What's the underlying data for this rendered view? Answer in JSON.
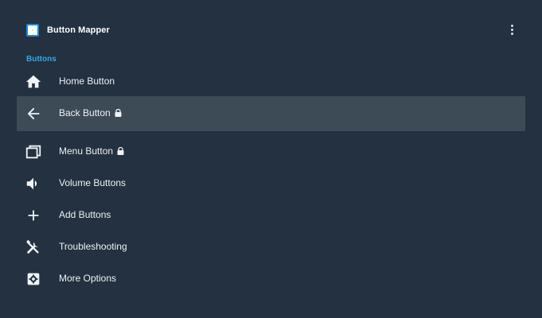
{
  "app": {
    "title": "Button Mapper",
    "icon": "button-mapper-app-icon"
  },
  "header": {
    "overflow_icon": "more-vertical-icon"
  },
  "section": {
    "title": "Buttons"
  },
  "menu": {
    "items": [
      {
        "label": "Home Button",
        "icon": "home-icon",
        "locked": false,
        "selected": false
      },
      {
        "label": "Back Button",
        "icon": "arrow-back-icon",
        "locked": true,
        "selected": true
      },
      {
        "label": "Menu Button",
        "icon": "recent-apps-icon",
        "locked": true,
        "selected": false
      },
      {
        "label": "Volume Buttons",
        "icon": "volume-icon",
        "locked": false,
        "selected": false
      },
      {
        "label": "Add Buttons",
        "icon": "plus-icon",
        "locked": false,
        "selected": false
      },
      {
        "label": "Troubleshooting",
        "icon": "tools-icon",
        "locked": false,
        "selected": false
      },
      {
        "label": "More Options",
        "icon": "settings-box-icon",
        "locked": false,
        "selected": false
      }
    ]
  },
  "colors": {
    "background": "#233140",
    "selected_row": "#3d4b57",
    "accent": "#33a9e8",
    "app_icon": "#1e88e5",
    "text": "#eef2f5"
  }
}
